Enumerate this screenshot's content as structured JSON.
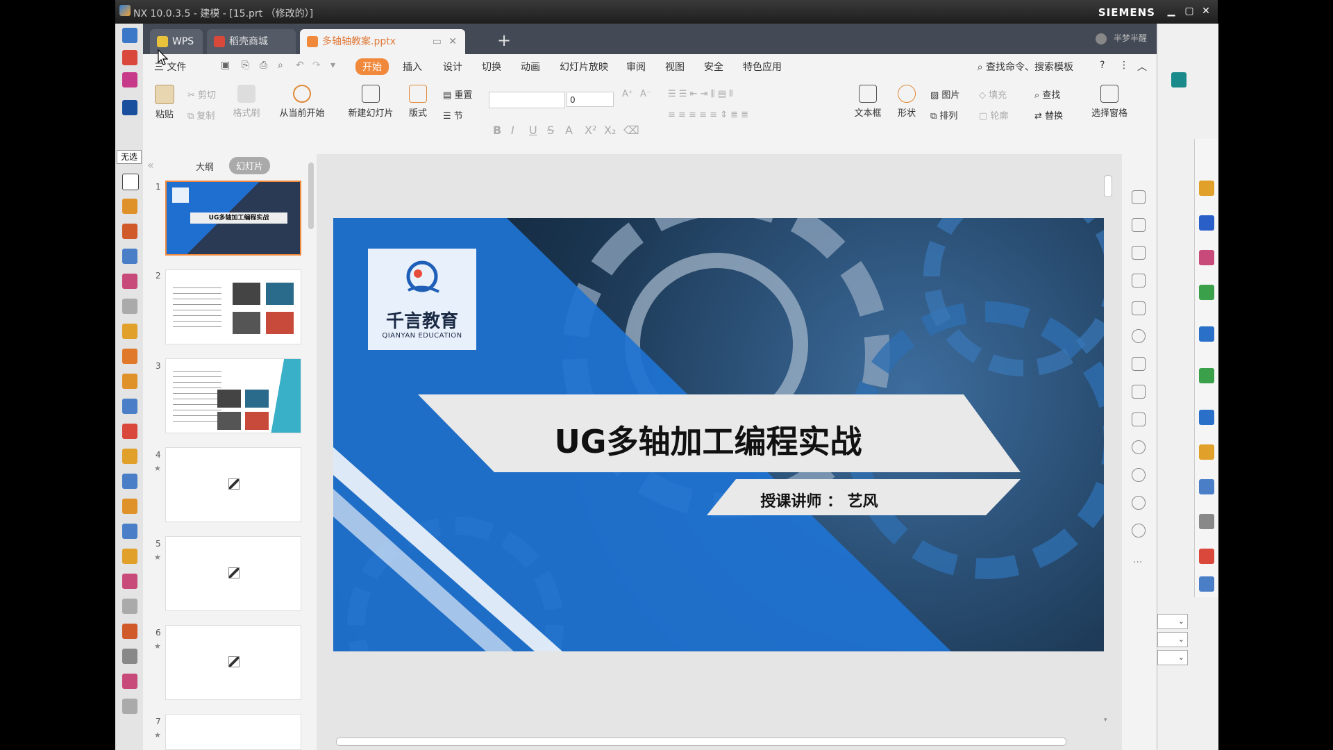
{
  "nx": {
    "title": "NX 10.0.3.5 - 建模 - [15.prt （修改的）]",
    "brand": "SIEMENS",
    "left_label": "无选",
    "colors": {
      "accent": "#f0893c",
      "titlebar": "#2a2a2a"
    }
  },
  "wps": {
    "tabs": [
      {
        "label": "WPS",
        "icon": "wps-logo-icon"
      },
      {
        "label": "稻壳商城",
        "icon": "docer-icon"
      },
      {
        "label": "多轴轴教案.pptx",
        "icon": "pptx-file-icon"
      }
    ],
    "add_tab": "+",
    "user": "半梦半醒",
    "menu": {
      "file": "三 文件",
      "items": [
        "开始",
        "插入",
        "设计",
        "切换",
        "动画",
        "幻灯片放映",
        "审阅",
        "视图",
        "安全",
        "特色应用"
      ],
      "search": "查找命令、搜索模板",
      "help": "?"
    },
    "ribbon": {
      "paste": "粘贴",
      "cut": "剪切",
      "copy": "复制",
      "format_painter": "格式刷",
      "from_current": "从当前开始",
      "new_slide": "新建幻灯片",
      "layout": "版式",
      "reset": "重置",
      "section": "节",
      "font_size": "0",
      "text_box": "文本框",
      "shape": "形状",
      "picture": "图片",
      "arrange": "排列",
      "fill": "填充",
      "outline": "轮廓",
      "find": "查找",
      "replace": "替换",
      "select_pane": "选择窗格"
    },
    "pane": {
      "outline": "大纲",
      "slides": "幻灯片",
      "thumbs": [
        {
          "num": "1",
          "title": "UG多轴加工编程实战"
        },
        {
          "num": "2"
        },
        {
          "num": "3"
        },
        {
          "num": "4"
        },
        {
          "num": "5"
        },
        {
          "num": "6"
        },
        {
          "num": "7"
        }
      ]
    },
    "slide": {
      "logo_cn": "千言教育",
      "logo_en": "QIANYAN EDUCATION",
      "title": "UG多轴加工编程实战",
      "subtitle": "授课讲师 ： 艺风"
    }
  }
}
